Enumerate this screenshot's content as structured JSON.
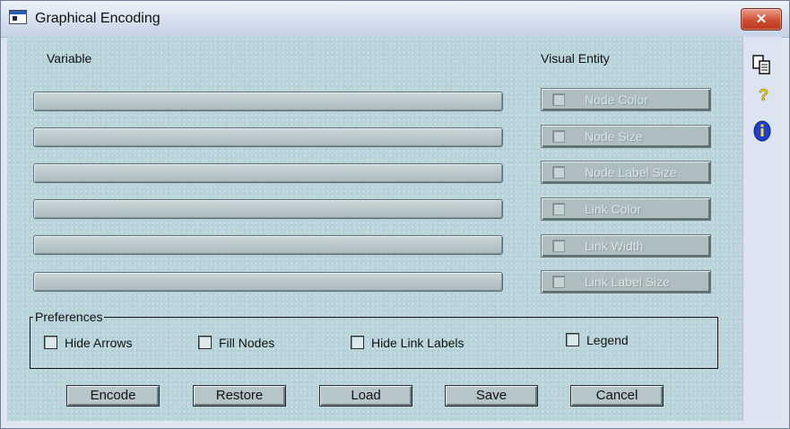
{
  "window": {
    "title": "Graphical Encoding",
    "close_symbol": "✕"
  },
  "headers": {
    "variable": "Variable",
    "visual_entity": "Visual Entity"
  },
  "variable_fields": [
    "",
    "",
    "",
    "",
    "",
    ""
  ],
  "visual_entities": [
    {
      "label": "Node Color",
      "checked": false
    },
    {
      "label": "Node Size",
      "checked": false
    },
    {
      "label": "Node Label Size",
      "checked": false
    },
    {
      "label": "Link Color",
      "checked": false
    },
    {
      "label": "Link Width",
      "checked": false
    },
    {
      "label": "Link Label Size",
      "checked": false
    }
  ],
  "preferences": {
    "legend": "Preferences",
    "options": [
      {
        "label": "Hide Arrows",
        "checked": false
      },
      {
        "label": "Fill Nodes",
        "checked": false
      },
      {
        "label": "Hide Link Labels",
        "checked": false
      },
      {
        "label": "Legend",
        "checked": false
      }
    ]
  },
  "buttons": {
    "encode": "Encode",
    "restore": "Restore",
    "load": "Load",
    "save": "Save",
    "cancel": "Cancel"
  },
  "side_icons": [
    "copy-icon",
    "help-icon",
    "info-icon"
  ],
  "colors": {
    "client_bg": "#b8d3d9",
    "close_red": "#cf4f34",
    "info_blue": "#1d3fd1",
    "help_yellow": "#e8d800"
  }
}
